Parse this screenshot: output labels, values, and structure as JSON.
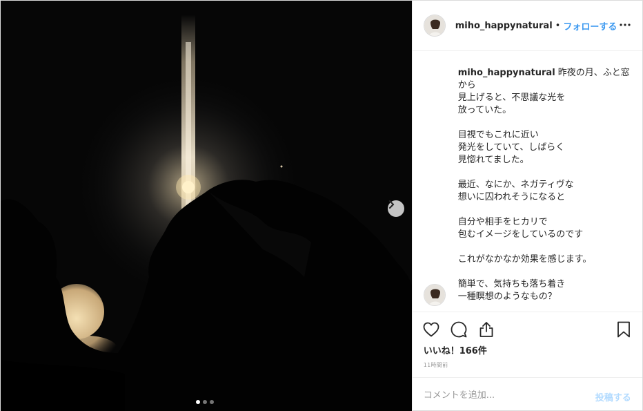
{
  "colors": {
    "link": "#3897f0",
    "post_disabled": "#b3dbff",
    "text": "#262626",
    "muted": "#999999",
    "border": "#efefef"
  },
  "header": {
    "username": "miho_happynatural",
    "separator": "•",
    "follow_label": "フォローする",
    "more_icon": "ellipsis-horizontal-icon"
  },
  "photo": {
    "next_icon": "chevron-right-icon",
    "carousel": {
      "total": 3,
      "active": 1
    }
  },
  "caption": {
    "username": "miho_happynatural",
    "text": " 昨夜の月、ふと窓から\n見上げると、不思議な光を\n放っていた。\n\n目視でもこれに近い\n発光をしていて、しばらく\n見惚れてました。\n\n最近、なにか、ネガティヴな\n想いに囚われそうになると\n\n自分や相手をヒカリで\n包むイメージをしているのです\n\nこれがなかなか効果を感じます。\n\n簡単で、気持ちも落ち着き\n一種瞑想のようなもの？"
  },
  "actions": {
    "like_icon": "heart-icon",
    "comment_icon": "comment-bubble-icon",
    "share_icon": "share-icon",
    "save_icon": "bookmark-icon",
    "likes_text": "いいね！166件",
    "time_text": "11時間前"
  },
  "comment_box": {
    "placeholder": "コメントを追加...",
    "post_label": "投稿する"
  }
}
